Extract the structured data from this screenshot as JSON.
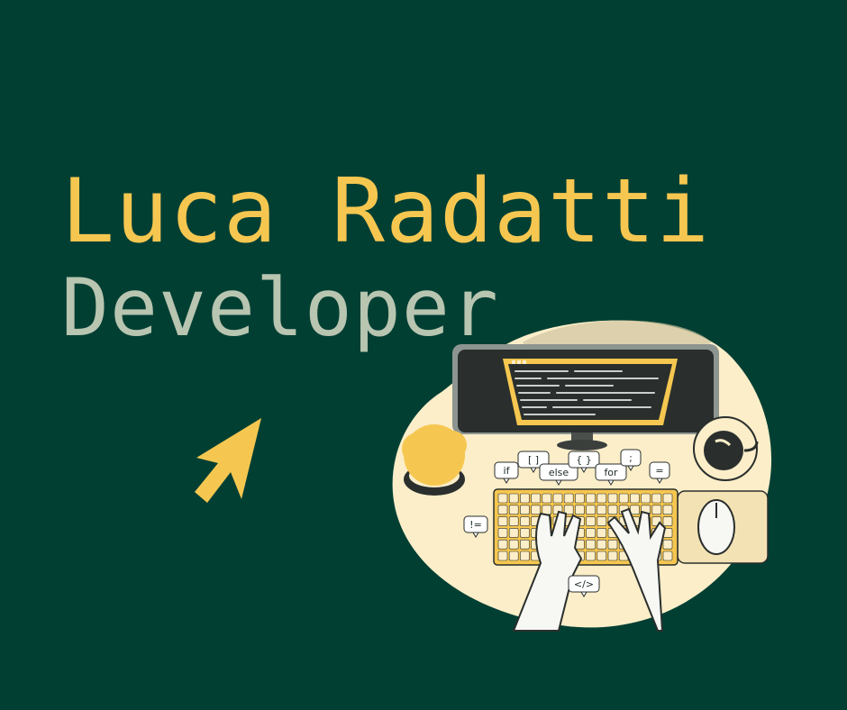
{
  "header": {
    "name": "Luca Radatti",
    "role": "Developer"
  },
  "illustration": {
    "code_chips": [
      "if",
      "[ ]",
      "else",
      "{ }",
      "for",
      ";",
      "=",
      "!=",
      "</>"
    ]
  },
  "colors": {
    "background": "#023f33",
    "accent": "#f6c750",
    "subtitle": "#b8c5b0",
    "cream": "#fbeec9"
  }
}
